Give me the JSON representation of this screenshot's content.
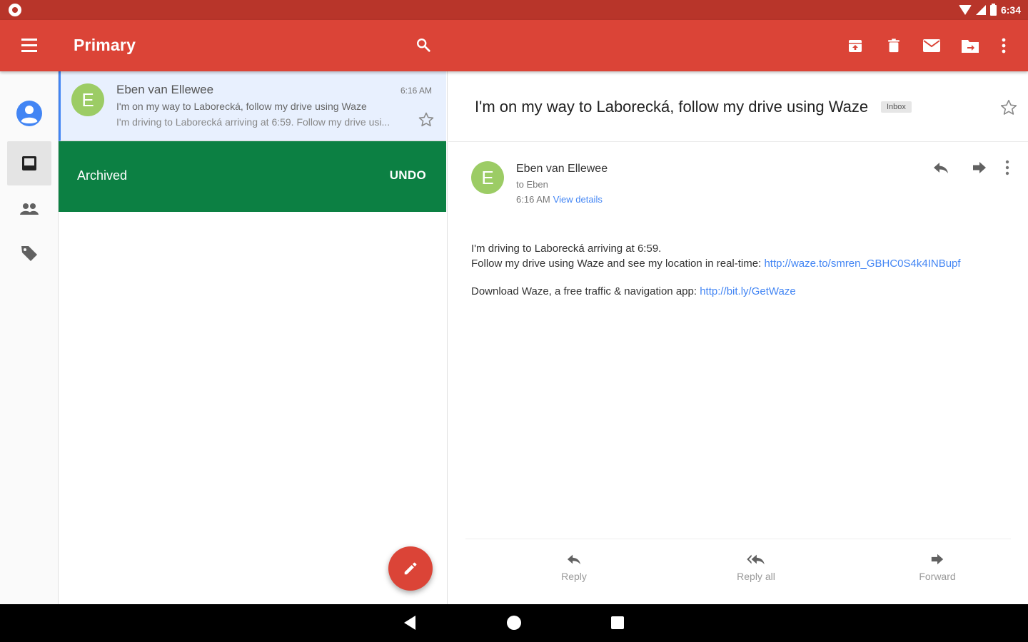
{
  "status_bar": {
    "time": "6:34"
  },
  "toolbar": {
    "title": "Primary",
    "icons": [
      "menu-icon",
      "search-icon",
      "archive-icon",
      "delete-icon",
      "mail-icon",
      "move-to-icon",
      "more-vert-icon"
    ],
    "color": "#db4437"
  },
  "rail": {
    "items": [
      {
        "name": "account",
        "icon": "account-circle-icon",
        "active": false
      },
      {
        "name": "inbox",
        "icon": "inbox-icon",
        "active": true
      },
      {
        "name": "contacts",
        "icon": "people-icon",
        "active": false
      },
      {
        "name": "labels",
        "icon": "label-icon",
        "active": false
      }
    ]
  },
  "conversation": {
    "avatar_letter": "E",
    "sender": "Eben van Ellewee",
    "time": "6:16 AM",
    "subject": "I'm on my way to Laborecká, follow my drive using Waze",
    "snippet": "I'm driving to Laborecká arriving at 6:59. Follow my drive usi...",
    "starred": false
  },
  "snackbar": {
    "text": "Archived",
    "action": "UNDO",
    "color": "#0c8043"
  },
  "fab": {
    "icon": "pencil-icon"
  },
  "detail": {
    "subject": "I'm on my way to Laborecká, follow my drive using Waze",
    "label": "Inbox",
    "starred": false,
    "message": {
      "avatar_letter": "E",
      "sender": "Eben van Ellewee",
      "to": "to Eben",
      "time": "6:16 AM",
      "view_details": "View details",
      "body_line1": "I'm driving to Laborecká arriving at 6:59.",
      "body_line2": "Follow my drive using Waze and see my location in real-time: ",
      "body_link1": "http://waze.to/smren_GBHC0S4k4INBupf",
      "body_line3": "Download Waze, a free traffic & navigation app: ",
      "body_link2": "http://bit.ly/GetWaze"
    },
    "actions": [
      {
        "label": "Reply",
        "icon": "reply-icon"
      },
      {
        "label": "Reply all",
        "icon": "reply-all-icon"
      },
      {
        "label": "Forward",
        "icon": "forward-icon"
      }
    ]
  }
}
